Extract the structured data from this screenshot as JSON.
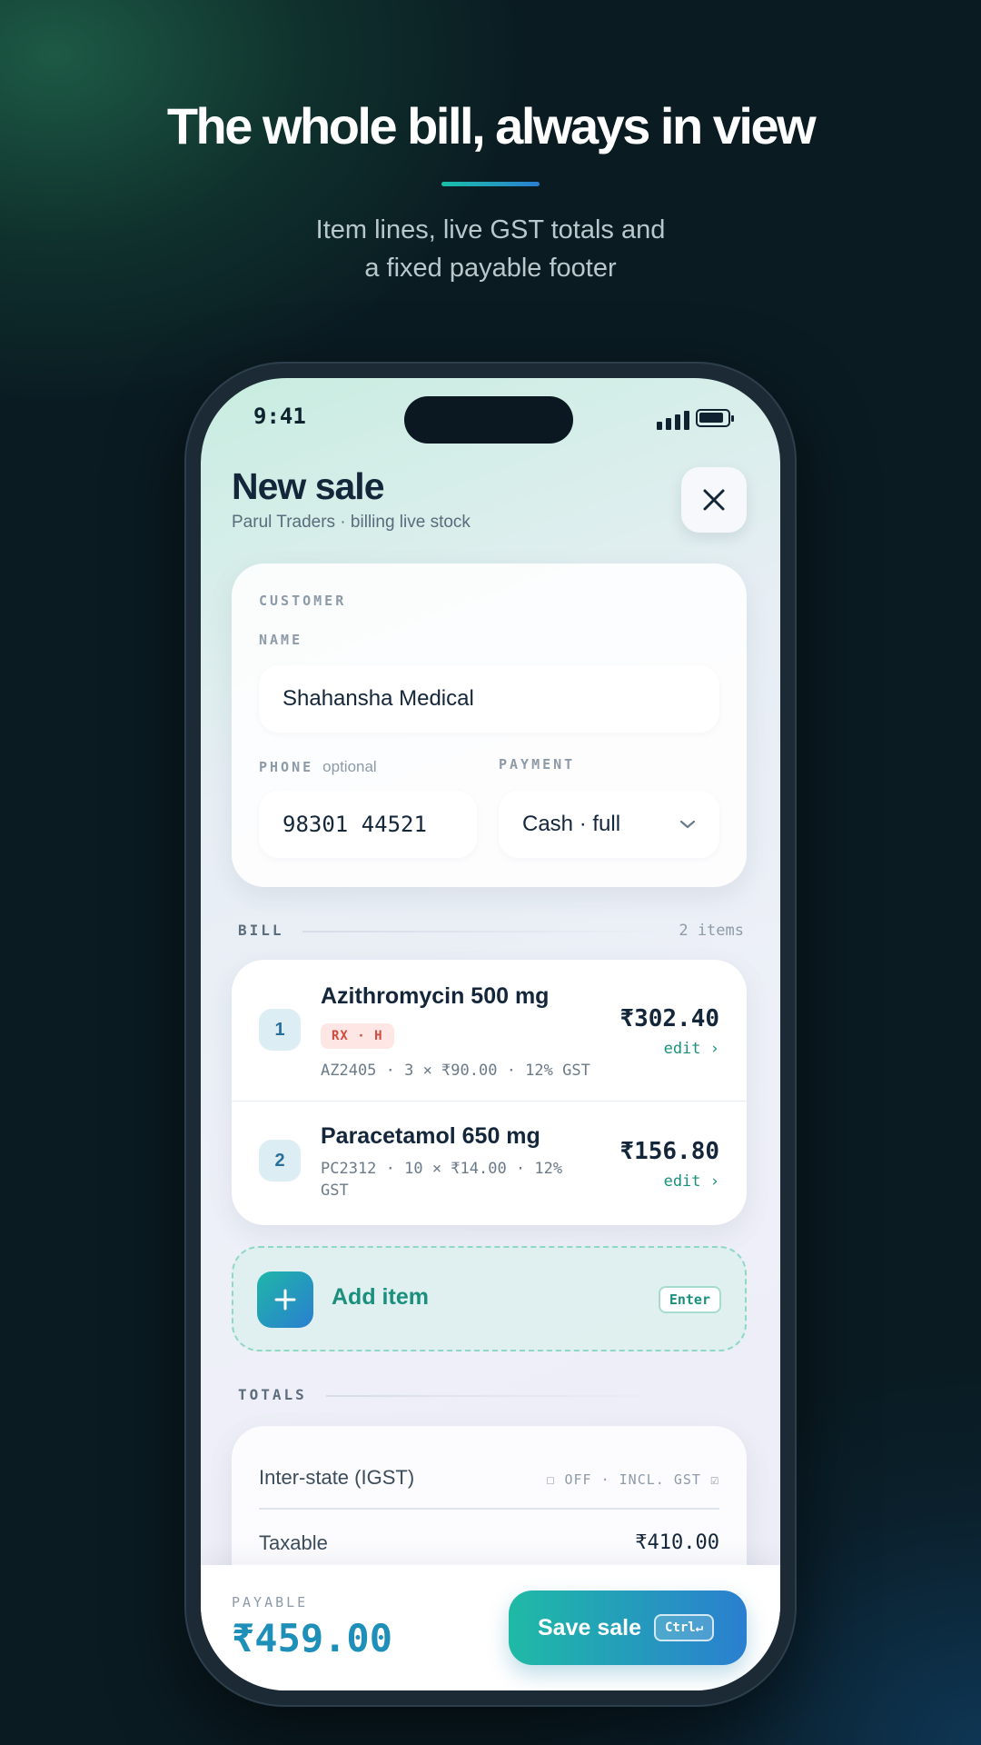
{
  "hero": {
    "title": "The whole bill, always in view",
    "subtitle_line1": "Item lines, live GST totals and",
    "subtitle_line2": "a fixed payable footer"
  },
  "status_bar": {
    "time": "9:41"
  },
  "header": {
    "title": "New sale",
    "subtitle": "Parul Traders · billing live stock",
    "close_icon": "close-icon"
  },
  "customer": {
    "section_label": "CUSTOMER",
    "name_label": "NAME",
    "name_value": "Shahansha Medical",
    "phone_label": "PHONE",
    "phone_optional": "optional",
    "phone_value": "98301 44521",
    "payment_label": "PAYMENT",
    "payment_value": "Cash · full"
  },
  "bill": {
    "section_label": "BILL",
    "count": "2 items",
    "items": [
      {
        "index": "1",
        "name": "Azithromycin 500 mg",
        "badge": "RX · H",
        "meta": "AZ2405 · 3 × ₹90.00 · 12% GST",
        "price": "₹302.40",
        "edit": "edit ›"
      },
      {
        "index": "2",
        "name": "Paracetamol 650 mg",
        "meta": "PC2312 · 10 × ₹14.00 · 12% GST",
        "price": "₹156.80",
        "edit": "edit ›"
      }
    ]
  },
  "add_item": {
    "label": "Add item",
    "shortcut": "Enter"
  },
  "totals": {
    "section_label": "TOTALS",
    "interstate_label": "Inter-state (IGST)",
    "interstate_status": "☐ OFF · INCL. GST ☑",
    "taxable_label": "Taxable",
    "taxable_value": "₹410.00"
  },
  "footer": {
    "payable_label": "PAYABLE",
    "payable_value": "₹459.00",
    "save_label": "Save sale",
    "save_shortcut": "Ctrl↵"
  },
  "colors": {
    "accent_teal": "#1fbaa6",
    "accent_blue": "#2a7fd0",
    "badge_red": "#d04a3e",
    "ink": "#13263a"
  }
}
